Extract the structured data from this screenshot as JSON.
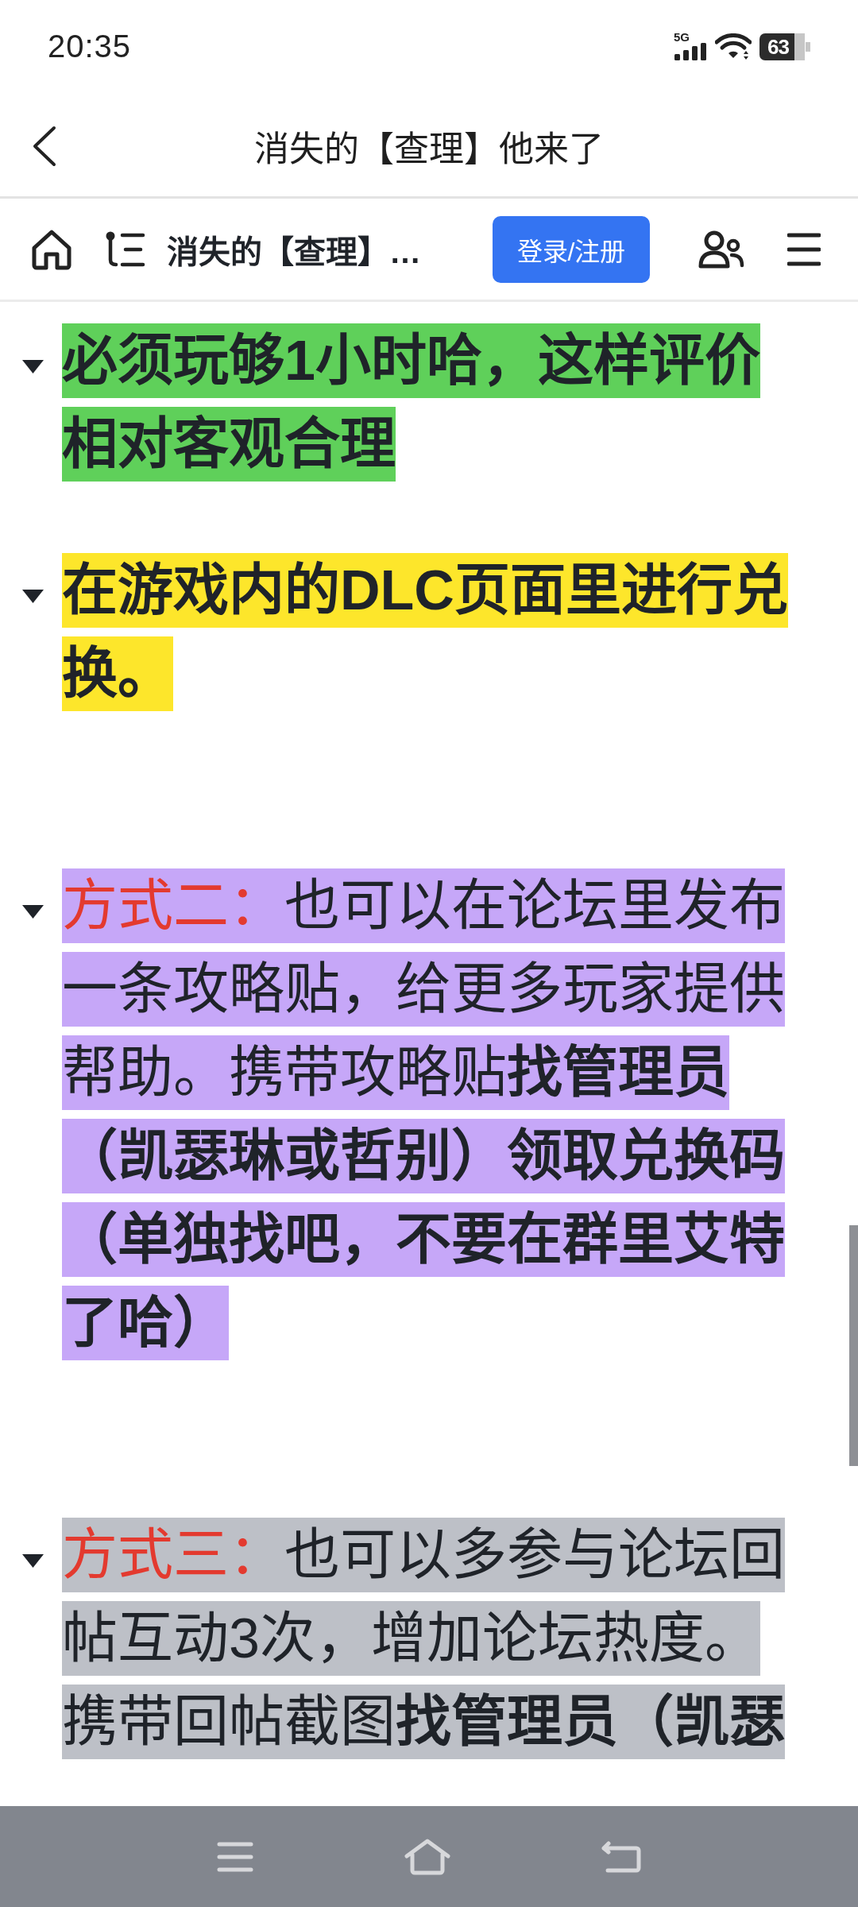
{
  "status_bar": {
    "time": "20:35",
    "network": "5G",
    "battery": "63"
  },
  "header": {
    "title": "消失的【查理】他来了"
  },
  "toolbar": {
    "title": "消失的【查理】…",
    "login_button": "登录/注册"
  },
  "items": [
    {
      "kind": "plain",
      "expanded": true,
      "color": "#5fd05a",
      "lines": [
        "**必须玩够1小时哈，这样评价**",
        "**相对客观合理**"
      ]
    },
    {
      "kind": "plain",
      "expanded": true,
      "color": "#fde62b",
      "lines": [
        "**在游戏内的DLC页面里进行兑**",
        "**换。**"
      ]
    },
    {
      "kind": "method",
      "expanded": true,
      "color": "#c6a7f8",
      "label": "方式二：",
      "lines": [
        "也可以在论坛里发布",
        "一条攻略贴，给更多玩家提供",
        "帮助。携带攻略贴**找管理员**",
        "**（凯瑟琳或哲别）领取兑换码**",
        "**（单独找吧，不要在群里艾特**",
        "**了哈）**"
      ]
    },
    {
      "kind": "method",
      "expanded": true,
      "color": "#bdc0c7",
      "label": "方式三：",
      "lines": [
        "也可以多参与论坛回",
        "帖互动3次，增加论坛热度。",
        "携带回帖截图**找管理员（凯瑟**"
      ]
    }
  ]
}
